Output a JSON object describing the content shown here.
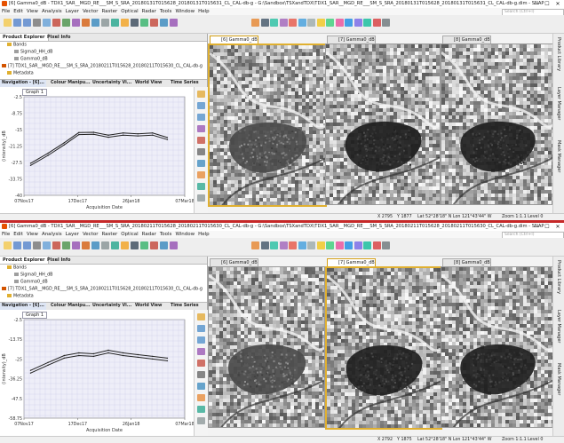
{
  "windows": [
    {
      "title": "[6] Gamma0_dB - TDX1_SAR__MGD_RE___SM_S_SRA_20180131T015628_20180131T015631_CL_CAL-db-g - G:\\Sandbox\\TSXandTDX\\TDX1_SAR__MGD_RE___SM_S_SRA_20180131T015628_20180131T015631_CL_CAL-db-g.dim - SNAP",
      "tree": {
        "bands": "Bands",
        "band1": "Sigma0_HH_dB",
        "band2": "Gamma0_dB",
        "product": "[7] TDX1_SAR__MGD_RE___SM_S_SRA_20180211T015628_20180211T015630_CL_CAL-db-g",
        "metadata": "Metadata"
      },
      "nav_tabs": [
        "Navigation - [6]...",
        "Colour Manipu...",
        "Uncertainty Vi...",
        "World View",
        "Time Series"
      ],
      "graph_tab": "Graph 1",
      "image_tabs": [
        "[6] Gamma0_dB",
        "[7] Gamma0_dB",
        "[8] Gamma0_dB"
      ],
      "status": {
        "x": "X  2795",
        "y": "Y  1877",
        "latlon": "Lat 52°28'18\" N  Lon 121°43'44\" W",
        "zoom": "Zoom 1:1.1  Level 0"
      }
    },
    {
      "title": "[6] Gamma0_dB - TDX1_SAR__MGD_RE___SM_S_SRA_20180211T015628_20180211T015630_CL_CAL-db-g - G:\\Sandbox\\TSXandTDX\\TDX1_SAR__MGD_RE___SM_S_SRA_20180211T015628_20180211T015630_CL_CAL-db-g.dim - SNAP",
      "tree": {
        "bands": "Bands",
        "band1": "Sigma0_HH_dB",
        "band2": "Gamma0_dB",
        "product": "[7] TDX1_SAR__MGD_RE___SM_S_SRA_20180211T015628_20180211T015630_CL_CAL-db-g",
        "metadata": "Metadata"
      },
      "nav_tabs": [
        "Navigation - [6]...",
        "Colour Manipu...",
        "Uncertainty Vi...",
        "World View",
        "Time Series"
      ],
      "graph_tab": "Graph 1",
      "image_tabs": [
        "[6] Gamma0_dB",
        "[7] Gamma0_dB",
        "[8] Gamma0_dB"
      ],
      "status": {
        "x": "X  2792",
        "y": "Y  1875",
        "latlon": "Lat 52°28'18\" N  Lon 121°43'44\" W",
        "zoom": "Zoom 1:1.1  Level 0"
      }
    }
  ],
  "menu": [
    "File",
    "Edit",
    "View",
    "Analysis",
    "Layer",
    "Vector",
    "Raster",
    "Optical",
    "Radar",
    "Tools",
    "Window",
    "Help"
  ],
  "search_placeholder": "Search (Ctrl+I)",
  "panel_tabs": [
    "Product Explorer",
    "Pixel Info"
  ],
  "right_tools": [
    "Product Library",
    "Layer Manager",
    "Mask Manager"
  ],
  "colors": {
    "accent_orange": "#e0b030",
    "separator_red": "#c62828",
    "series": "#222222",
    "grid_bg": "#eeeef8"
  },
  "chart_data": [
    {
      "type": "line",
      "ylabel": "(intensity)_dB",
      "xlabel": "Acquisition Date",
      "x_ticks": [
        "07Nov17",
        "17Dec17",
        "26Jan18",
        "07Mar18"
      ],
      "y_ticks": [
        "-2.5",
        "-8.75",
        "-15",
        "-21.25",
        "-27.5",
        "-33.75",
        "-40"
      ],
      "ylim": [
        -40,
        -2.5
      ],
      "grid": true,
      "x": [
        "2017-11-12",
        "2017-11-25",
        "2017-12-07",
        "2017-12-18",
        "2017-12-29",
        "2018-01-09",
        "2018-01-20",
        "2018-01-31",
        "2018-02-11",
        "2018-02-22"
      ],
      "series": [
        {
          "values": [
            -27.8,
            -24.0,
            -20.0,
            -16.1,
            -16.0,
            -17.1,
            -16.3,
            -16.6,
            -16.3,
            -18.0
          ]
        },
        {
          "values": [
            -28.6,
            -24.8,
            -20.8,
            -16.9,
            -16.8,
            -17.9,
            -17.1,
            -17.4,
            -17.1,
            -18.8
          ]
        }
      ]
    },
    {
      "type": "line",
      "ylabel": "(intensity)_dB",
      "xlabel": "Acquisition Date",
      "x_ticks": [
        "07Nov17",
        "17Dec17",
        "26Jan18",
        "07Mar18"
      ],
      "y_ticks": [
        "-2.5",
        "-13.75",
        "-25",
        "-36.25",
        "-47.5",
        "-58.75"
      ],
      "ylim": [
        -58.75,
        -2.5
      ],
      "grid": true,
      "x": [
        "2017-11-12",
        "2017-11-25",
        "2017-12-07",
        "2017-12-18",
        "2017-12-29",
        "2018-01-09",
        "2018-01-20",
        "2018-01-31",
        "2018-02-11",
        "2018-02-22"
      ],
      "series": [
        {
          "values": [
            -31.5,
            -27.0,
            -23.0,
            -21.5,
            -22.0,
            -20.0,
            -21.5,
            -22.5,
            -23.5,
            -24.5
          ]
        },
        {
          "values": [
            -33.0,
            -28.5,
            -24.5,
            -23.0,
            -23.5,
            -21.5,
            -23.0,
            -24.0,
            -25.0,
            -26.0
          ]
        }
      ]
    }
  ]
}
